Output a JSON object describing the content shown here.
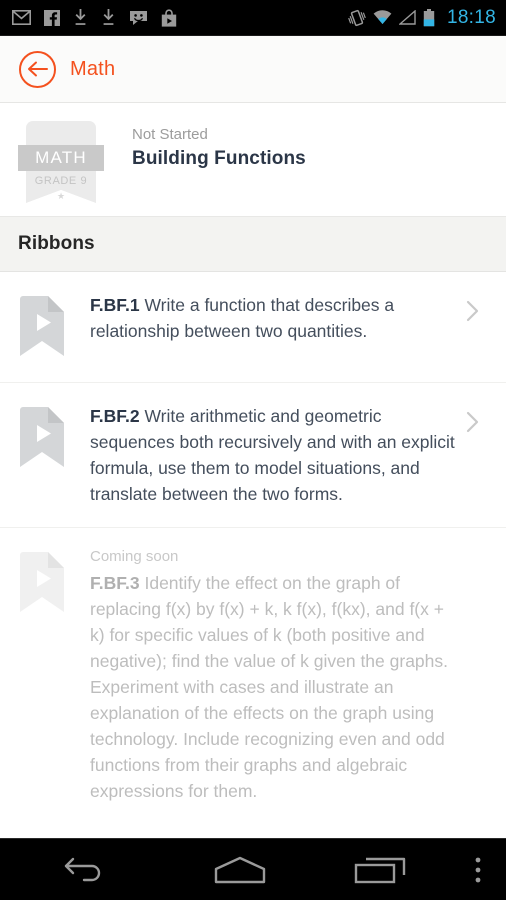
{
  "statusbar": {
    "left_icons": [
      "gmail-icon",
      "facebook-icon",
      "download-icon",
      "download-icon",
      "messaging-icon",
      "play-store-icon"
    ],
    "right_icons": [
      "vibrate-icon",
      "wifi-icon",
      "signal-icon",
      "battery-icon"
    ],
    "time": "18:18",
    "accent_color": "#33b5e5",
    "background": "#000000"
  },
  "appbar": {
    "back_label": "back-arrow-icon",
    "title": "Math",
    "accent_color": "#f4511e",
    "background": "#fbfbfa"
  },
  "course": {
    "badge": {
      "subject": "MATH",
      "grade": "GRADE 9",
      "star": "★"
    },
    "status": "Not Started",
    "title": "Building Functions"
  },
  "section": {
    "title": "Ribbons"
  },
  "ribbons": [
    {
      "code": "F.BF.1",
      "text": " Write a function that describes a relationship between two quantities.",
      "state": "available",
      "badge": "",
      "icon": "ribbon-play-icon",
      "chevron": "chevron-right-icon"
    },
    {
      "code": "F.BF.2",
      "text": " Write arithmetic and geometric sequences both recursively and with an explicit formula, use them to model situations, and translate between the two forms.",
      "state": "available",
      "badge": "",
      "icon": "ribbon-play-icon",
      "chevron": "chevron-right-icon"
    },
    {
      "code": "F.BF.3",
      "text": " Identify the effect on the graph of replacing f(x) by f(x) + k, k f(x), f(kx), and f(x + k) for specific values of k (both positive and negative); find the value of k given the graphs. Experiment with cases and illustrate an explanation of the effects on the graph using technology. Include recognizing even and odd functions from their graphs and algebraic expressions for them.",
      "state": "disabled",
      "badge": "Coming soon",
      "icon": "ribbon-play-icon-disabled",
      "chevron": ""
    }
  ],
  "navbar": {
    "back": "android-back-icon",
    "home": "android-home-icon",
    "recents": "android-recents-icon",
    "menu": "android-overflow-icon"
  }
}
